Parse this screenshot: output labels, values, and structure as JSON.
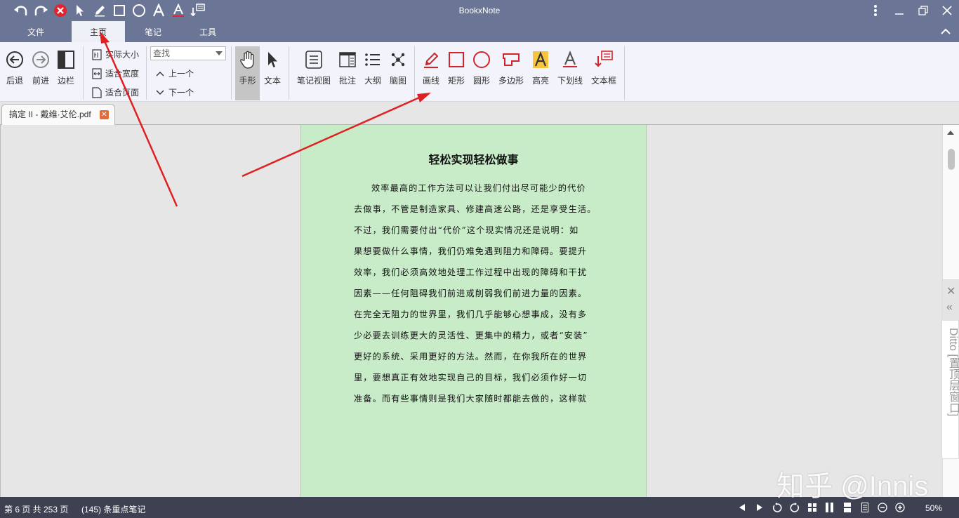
{
  "app": {
    "title": "BookxNote"
  },
  "menu": {
    "tabs": [
      {
        "label": "文件"
      },
      {
        "label": "主页"
      },
      {
        "label": "笔记"
      },
      {
        "label": "工具"
      }
    ]
  },
  "ribbon": {
    "back": "后退",
    "forward": "前进",
    "sidebar": "边栏",
    "actual_size": "实际大小",
    "fit_width": "适合宽度",
    "fit_page": "适合页面",
    "find_placeholder": "查找",
    "prev": "上一个",
    "next": "下一个",
    "hand": "手形",
    "text": "文本",
    "note_view": "笔记视图",
    "annotate": "批注",
    "outline": "大纲",
    "mindmap": "脑图",
    "draw_line": "画线",
    "rectangle": "矩形",
    "circle": "圆形",
    "polygon": "多边形",
    "highlight": "高亮",
    "underline": "下划线",
    "textbox": "文本框"
  },
  "doc_tab": {
    "label": "搞定 II - 戴维·艾伦.pdf"
  },
  "page": {
    "title": "轻松实现轻松做事",
    "lines": [
      "效率最高的工作方法可以让我们付出尽可能少的代价",
      "去做事，不管是制造家具、修建高速公路，还是享受生活。",
      "不过，我们需要付出“代价”这个现实情况还是说明：如",
      "果想要做什么事情，我们仍难免遇到阻力和障碍。要提升",
      "效率，我们必须高效地处理工作过程中出现的障碍和干扰",
      "因素——任何阻碍我们前进或削弱我们前进力量的因素。",
      "在完全无阻力的世界里，我们几乎能够心想事成，没有多",
      "少必要去训练更大的灵活性、更集中的精力，或者“安装”",
      "更好的系统、采用更好的方法。然而，在你我所在的世界",
      "里，要想真正有效地实现自己的目标，我们必须作好一切",
      "准备。而有些事情则是我们大家随时都能去做的，这样就"
    ]
  },
  "ditto": {
    "label": "Ditto [置顶层窗口]"
  },
  "status": {
    "page_info": "第 6 页 共 253 页",
    "notes_info": "(145) 条重点笔记",
    "zoom": "50%"
  },
  "watermark": {
    "text": "知乎 @Innis"
  },
  "colors": {
    "titlebar": "#6b7596",
    "ribbon": "#f3f4fb",
    "page": "#c8ebc8",
    "statusbar": "#3d4152",
    "annotation_arrow": "#e02020"
  }
}
